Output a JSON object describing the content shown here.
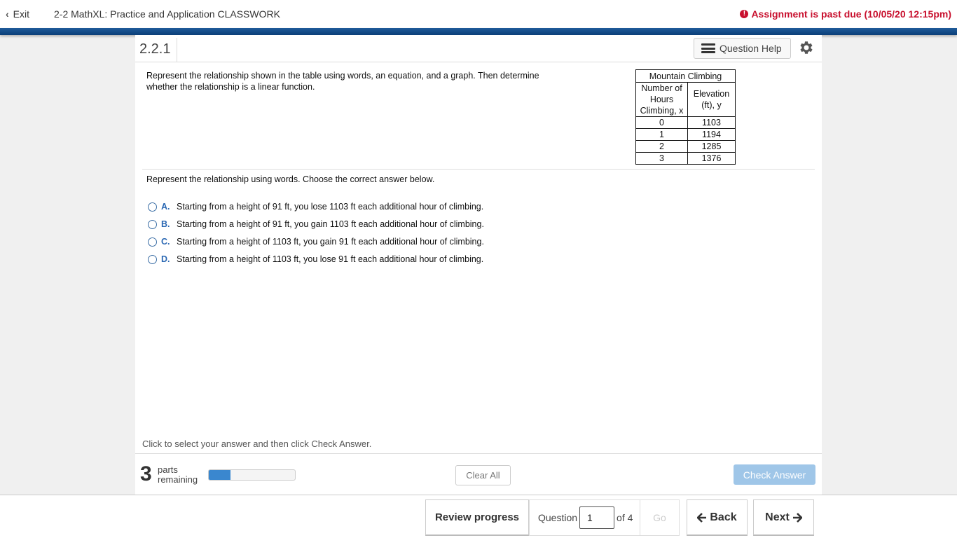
{
  "header": {
    "exit_label": "Exit",
    "assignment_title": "2-2 MathXL: Practice and Application CLASSWORK",
    "past_due": "Assignment is past due (10/05/20 12:15pm)",
    "colors": {
      "accent_blue": "#0b3f78",
      "past_due_red": "#c8102e"
    }
  },
  "question": {
    "number": "2.2.1",
    "help_label": "Question Help",
    "prompt": "Represent the relationship shown in the table using words, an equation, and a graph. Then determine whether the relationship is a linear function.",
    "table": {
      "caption": "Mountain Climbing",
      "headers": [
        "Number of Hours Climbing, x",
        "Elevation (ft), y"
      ],
      "rows": [
        [
          "0",
          "1103"
        ],
        [
          "1",
          "1194"
        ],
        [
          "2",
          "1285"
        ],
        [
          "3",
          "1376"
        ]
      ]
    },
    "instruction": "Represent the relationship using words. Choose the correct answer below.",
    "choices": [
      {
        "letter": "A.",
        "text": "Starting from a height of 91 ft, you lose 1103 ft each additional hour of climbing."
      },
      {
        "letter": "B.",
        "text": "Starting from a height of 91 ft, you gain 1103 ft each additional hour of climbing."
      },
      {
        "letter": "C.",
        "text": "Starting from a height of 1103 ft, you gain 91 ft each additional hour of climbing."
      },
      {
        "letter": "D.",
        "text": "Starting from a height of 1103 ft, you lose 91 ft each additional hour of climbing."
      }
    ],
    "hint": "Click to select your answer and then click Check Answer."
  },
  "status": {
    "parts_count": "3",
    "parts_label_1": "parts",
    "parts_label_2": "remaining",
    "progress_fraction": 0.25,
    "clear_all_label": "Clear All",
    "check_answer_label": "Check Answer"
  },
  "footer": {
    "review_label": "Review progress",
    "question_label": "Question",
    "question_value": "1",
    "of_label": "of 4",
    "go_label": "Go",
    "back_label": "Back",
    "next_label": "Next"
  },
  "icons": {
    "exit": "chevron-left-icon",
    "past_due": "exclamation-circle-icon",
    "help": "list-icon",
    "settings": "gear-icon",
    "back": "arrow-left-icon",
    "next": "arrow-right-icon"
  }
}
